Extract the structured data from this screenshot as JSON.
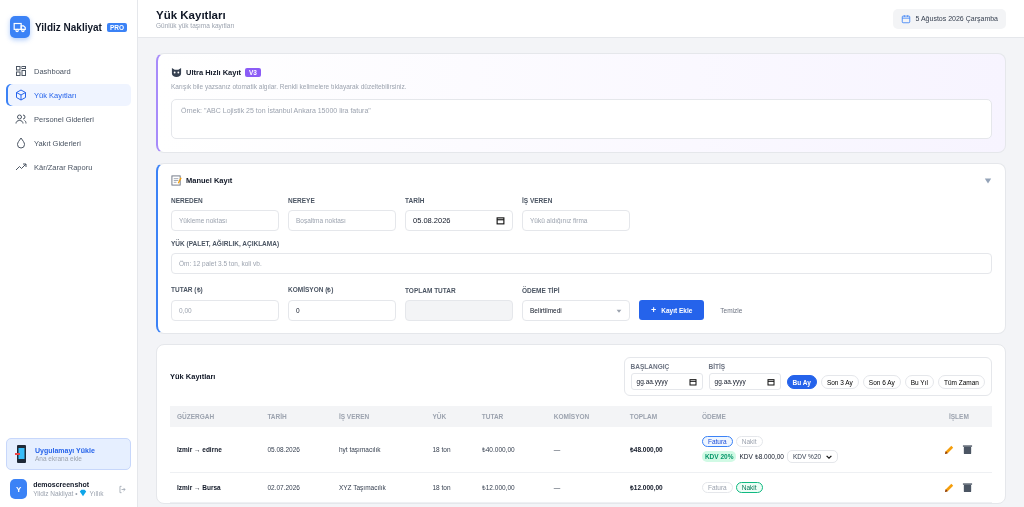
{
  "sidebar": {
    "brand": "Yildiz Nakliyat",
    "badge": "PRO",
    "items": [
      {
        "label": "Dashboard",
        "selected": false
      },
      {
        "label": "Yük Kayıtları",
        "selected": true
      },
      {
        "label": "Personel Giderleri",
        "selected": false
      },
      {
        "label": "Yakıt Giderleri",
        "selected": false
      },
      {
        "label": "Kâr/Zarar Raporu",
        "selected": false
      }
    ],
    "install": {
      "title": "Uygulamayı Yükle",
      "subtitle": "Ana ekrana ekle"
    },
    "user": {
      "initial": "Y",
      "name": "demoscreenshot",
      "company": "Yildiz Nakliyat •",
      "plan": "Yıllık"
    }
  },
  "header": {
    "title": "Yük Kayıtları",
    "subtitle": "Günlük yük taşıma kayıtları",
    "date": "5 Ağustos 2026 Çarşamba"
  },
  "quick": {
    "title": "Ultra Hızlı Kayıt",
    "badge": "V3",
    "hint": "Karışık bile yazsanız otomatik algılar. Renkli kelimelere tıklayarak düzeltebilirsiniz.",
    "placeholder": "Örnek: \"ABC Lojistik 25 ton İstanbul Ankara 15000 lira fatura\""
  },
  "manual": {
    "title": "Manuel Kayıt",
    "expanded": true,
    "row1": [
      {
        "label": "NEREDEN",
        "placeholder": "Yükleme noktası",
        "kind": "text"
      },
      {
        "label": "NEREYE",
        "placeholder": "Boşaltma noktası",
        "kind": "text"
      },
      {
        "label": "TARİH",
        "value": "05.08.2026",
        "kind": "date"
      },
      {
        "label": "İŞ VEREN",
        "placeholder": "Yükü aldığınız firma",
        "kind": "text"
      }
    ],
    "load": {
      "label": "YÜK (PALET, AĞIRLIK, AÇIKLAMA)",
      "placeholder": "Öm: 12 palet 3.5 ton, koli vb."
    },
    "row3": [
      {
        "label": "TUTAR (₺)",
        "placeholder": "0,00",
        "kind": "text"
      },
      {
        "label": "KOMİSYON (₺)",
        "value": "0",
        "kind": "text"
      },
      {
        "label": "TOPLAM TUTAR",
        "kind": "readonly"
      },
      {
        "label": "ÖDEME TİPİ",
        "value": "Belirtilmedi",
        "kind": "select"
      }
    ],
    "add": "Kayıt Ekle",
    "add_icon": "+",
    "clear": "Temizle"
  },
  "records": {
    "title": "Yük Kayıtları",
    "start_label": "BAŞLANGIÇ",
    "start": "gg.aa.yyyy",
    "end_label": "BİTİŞ",
    "end": "gg.aa.yyyy",
    "ranges": [
      {
        "label": "Bu Ay",
        "selected": true
      },
      {
        "label": "Son 3 Ay",
        "selected": false
      },
      {
        "label": "Son 6 Ay",
        "selected": false
      },
      {
        "label": "Bu Yıl",
        "selected": false
      },
      {
        "label": "Tüm Zaman",
        "selected": false
      }
    ],
    "columns": [
      "GÜZERGAH",
      "TARİH",
      "İŞ VEREN",
      "YÜK",
      "TUTAR",
      "KOMİSYON",
      "TOPLAM",
      "ÖDEME",
      "İŞLEM"
    ],
    "rows": [
      {
        "route": "Izmir → edirne",
        "date": "05.08.2026",
        "employer": "hyt taşımacılık",
        "load": "18 ton",
        "amount": "₺40.000,00",
        "commission": "—",
        "total": "₺48.000,00",
        "pay": [
          {
            "label": "Fatura",
            "selected": true
          },
          {
            "label": "Nakit",
            "selected": false
          }
        ],
        "vat_badge": "KDV 20%",
        "vat_amount": "KDV ₺8.000,00",
        "vat_select": "KDV %20"
      },
      {
        "route": "Izmir → Bursa",
        "date": "02.07.2026",
        "employer": "XYZ Taşımacılık",
        "load": "18 ton",
        "amount": "₺12.000,00",
        "commission": "—",
        "total": "₺12.000,00",
        "pay": [
          {
            "label": "Fatura",
            "selected": false
          },
          {
            "label": "Nakit",
            "selected": true
          }
        ]
      }
    ]
  }
}
